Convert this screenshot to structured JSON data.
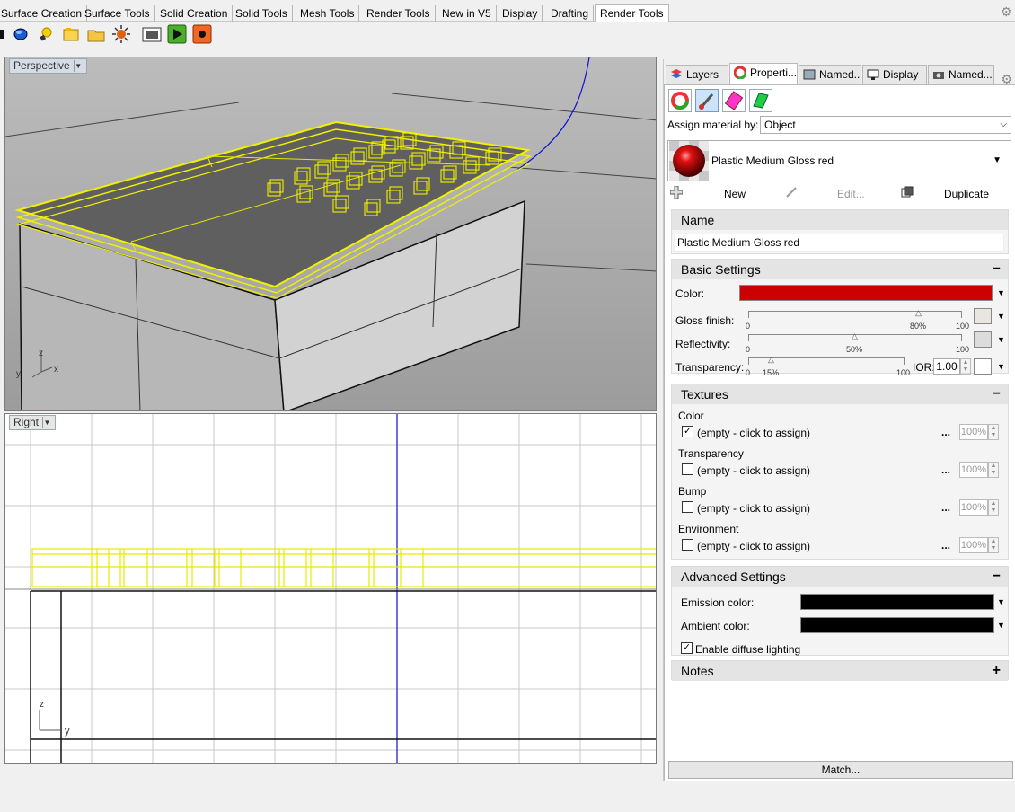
{
  "toolbar_tabs": [
    {
      "label": "Surface Creation"
    },
    {
      "label": "Surface Tools"
    },
    {
      "label": "Solid Creation"
    },
    {
      "label": "Solid Tools"
    },
    {
      "label": "Mesh Tools"
    },
    {
      "label": "Render Tools"
    },
    {
      "label": "New in V5"
    },
    {
      "label": "Display"
    },
    {
      "label": "Drafting"
    },
    {
      "label": "Render Tools"
    }
  ],
  "viewports": {
    "perspective_label": "Perspective",
    "right_label": "Right",
    "persp_axes": {
      "z": "z",
      "y": "y",
      "x": "x"
    },
    "right_axes": {
      "z": "z",
      "y": "y"
    }
  },
  "panel": {
    "tabs": [
      {
        "label": "Layers"
      },
      {
        "label": "Properti..."
      },
      {
        "label": "Named..."
      },
      {
        "label": "Display"
      },
      {
        "label": "Named..."
      }
    ],
    "assign_label": "Assign material by:",
    "assign_value": "Object",
    "material_name": "Plastic Medium Gloss red",
    "actions": {
      "new": "New",
      "edit": "Edit...",
      "duplicate": "Duplicate"
    },
    "name_section": {
      "title": "Name",
      "value": "Plastic Medium Gloss red"
    },
    "basic": {
      "title": "Basic Settings",
      "toggle": "−",
      "color_label": "Color:",
      "color": "#cc0000",
      "gloss_label": "Gloss finish:",
      "gloss_min": "0",
      "gloss_max": "100",
      "gloss_value": "80%",
      "gloss_level": 80,
      "reflect_label": "Reflectivity:",
      "reflect_min": "0",
      "reflect_max": "100",
      "reflect_value": "50%",
      "reflect_level": 50,
      "trans_label": "Transparency:",
      "trans_min": "0",
      "trans_max": "100",
      "trans_value": "15%",
      "trans_level": 15,
      "ior_label": "IOR:",
      "ior_value": "1.00"
    },
    "textures": {
      "title": "Textures",
      "toggle": "−",
      "items": [
        {
          "name": "Color",
          "text": "(empty - click to assign)",
          "checked": true,
          "pct": "100%",
          "dots": "..."
        },
        {
          "name": "Transparency",
          "text": "(empty - click to assign)",
          "checked": false,
          "pct": "100%",
          "dots": "..."
        },
        {
          "name": "Bump",
          "text": "(empty - click to assign)",
          "checked": false,
          "pct": "100%",
          "dots": "..."
        },
        {
          "name": "Environment",
          "text": "(empty - click to assign)",
          "checked": false,
          "pct": "100%",
          "dots": "..."
        }
      ]
    },
    "advanced": {
      "title": "Advanced Settings",
      "toggle": "−",
      "emission_label": "Emission color:",
      "ambient_label": "Ambient color:",
      "diffuse_label": "Enable diffuse lighting",
      "emission_color": "#000000",
      "ambient_color": "#000000"
    },
    "notes": {
      "title": "Notes",
      "toggle": "+"
    },
    "match_label": "Match..."
  }
}
